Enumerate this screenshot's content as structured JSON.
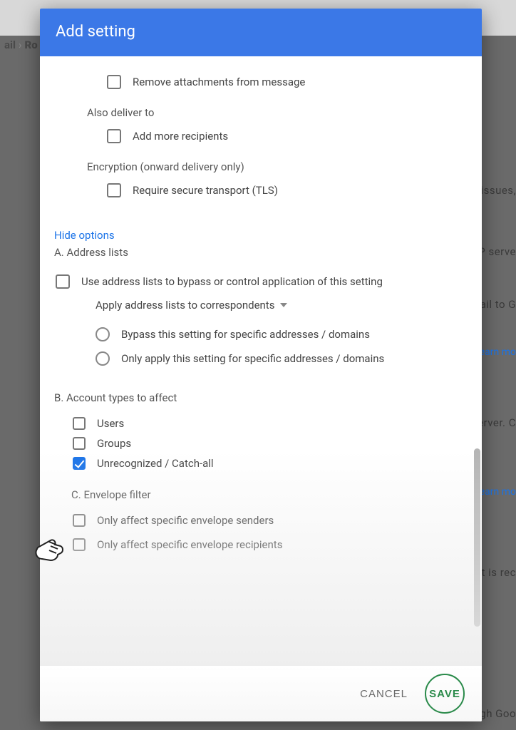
{
  "background": {
    "breadcrumb_prefix": "ail",
    "breadcrumb_current": "Ro",
    "right_snips": [
      "issues,",
      "P serve",
      "ail to G",
      "earn mo",
      "erver. C",
      "earn mo",
      "t is rec",
      "gh Goo"
    ]
  },
  "dialog": {
    "title": "Add setting",
    "remove_attachments": "Remove attachments from message",
    "also_deliver_header": "Also deliver to",
    "add_more_recipients": "Add more recipients",
    "encryption_header": "Encryption (onward delivery only)",
    "require_tls": "Require secure transport (TLS)",
    "hide_options": "Hide options",
    "sectionA": "A. Address lists",
    "use_address_lists": "Use address lists to bypass or control application of this setting",
    "apply_lists_dropdown": "Apply address lists to correspondents",
    "radio_bypass": "Bypass this setting for specific addresses / domains",
    "radio_only_apply": "Only apply this setting for specific addresses / domains",
    "sectionB": "B. Account types to affect",
    "cb_users": "Users",
    "cb_groups": "Groups",
    "cb_catchall": "Unrecognized / Catch-all",
    "sectionC": "C. Envelope filter",
    "cb_env_senders": "Only affect specific envelope senders",
    "cb_env_recipients": "Only affect specific envelope recipients",
    "cancel": "CANCEL",
    "save": "SAVE"
  }
}
